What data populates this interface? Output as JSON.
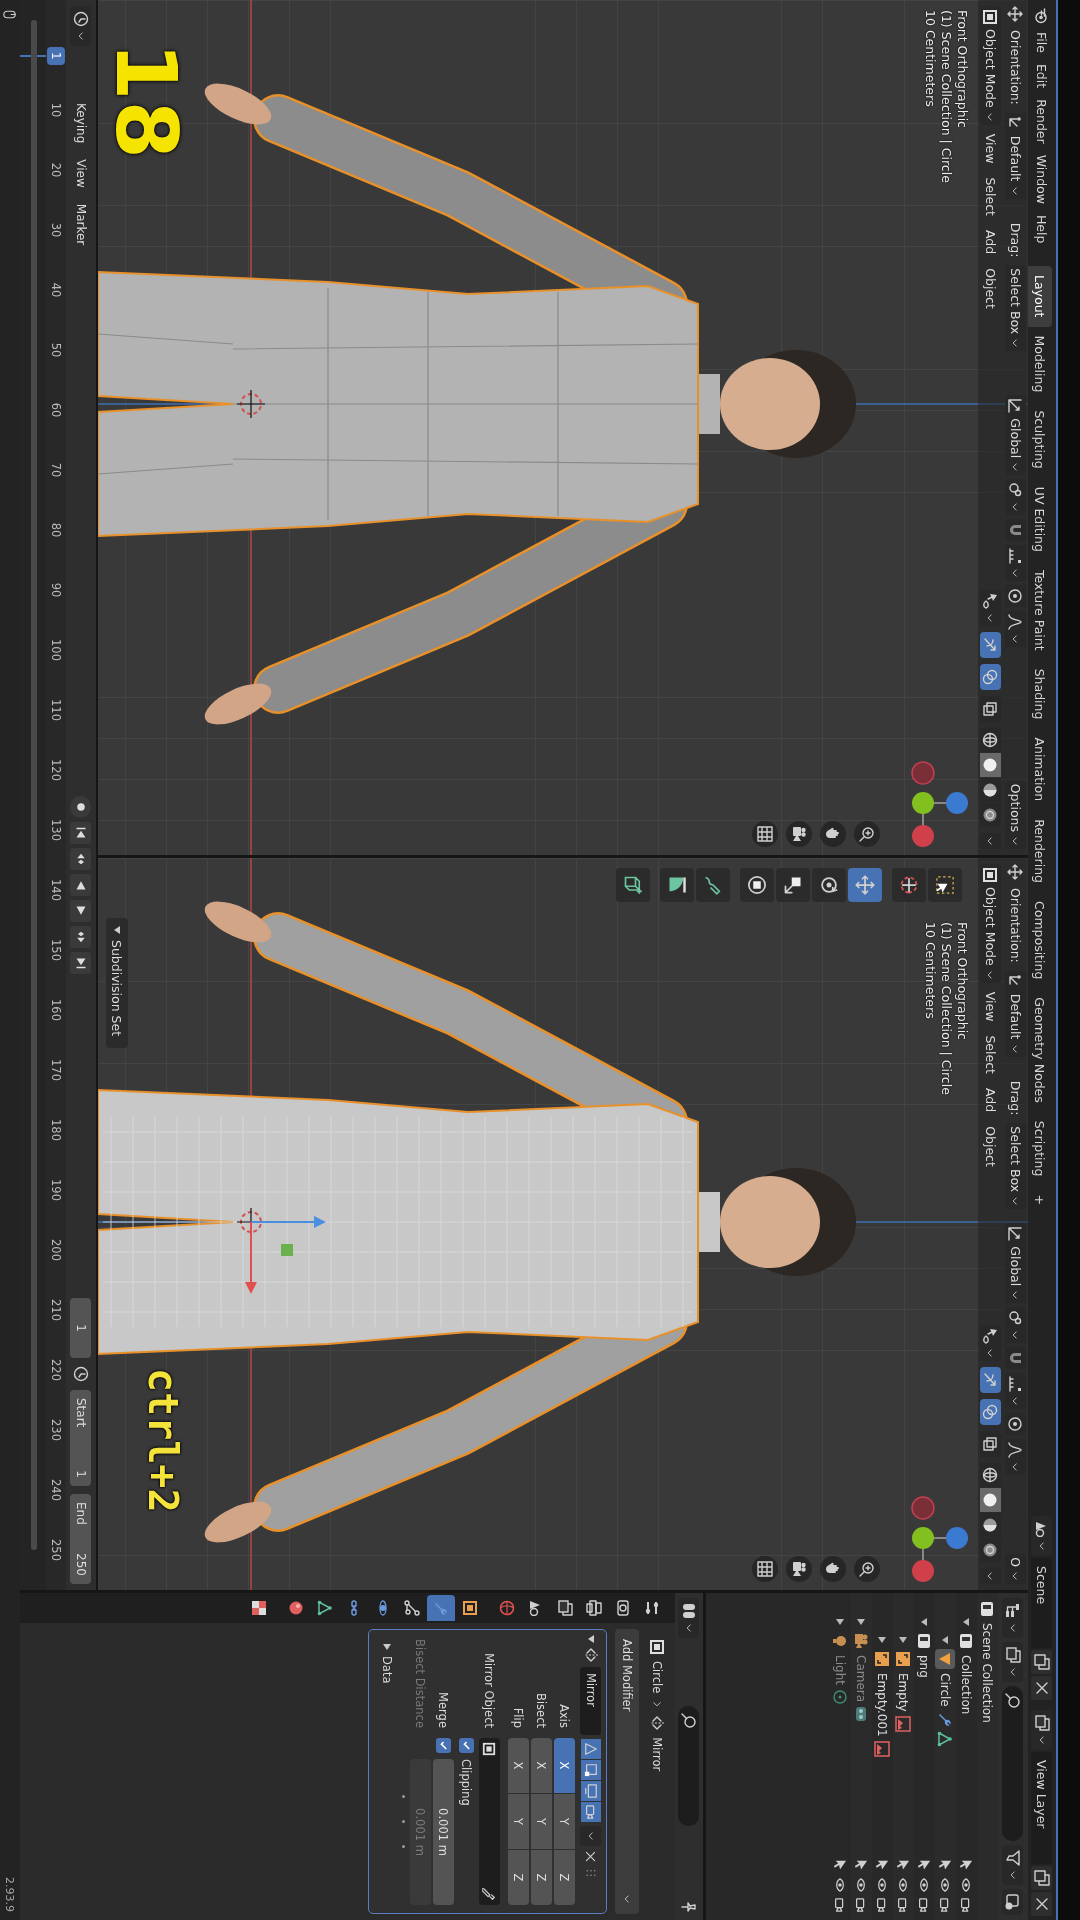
{
  "menu": [
    "File",
    "Edit",
    "Render",
    "Window",
    "Help"
  ],
  "workspaces": [
    {
      "label": "Layout",
      "selected": true
    },
    {
      "label": "Modeling",
      "selected": false
    },
    {
      "label": "Sculpting",
      "selected": false
    },
    {
      "label": "UV Editing",
      "selected": false
    },
    {
      "label": "Texture Paint",
      "selected": false
    },
    {
      "label": "Shading",
      "selected": false
    },
    {
      "label": "Animation",
      "selected": false
    },
    {
      "label": "Rendering",
      "selected": false
    },
    {
      "label": "Compositing",
      "selected": false
    },
    {
      "label": "Geometry Nodes",
      "selected": false
    },
    {
      "label": "Scripting",
      "selected": false
    }
  ],
  "add_workspace": "+",
  "scene": "Scene",
  "view_layer": "View Layer",
  "viewports": [
    {
      "orientation_label": "Orientation:",
      "orientation": "Default",
      "drag_label": "Drag:",
      "drag": "Select Box",
      "transform_orientation": "Global",
      "options": "Options",
      "mode": "Object Mode",
      "menus": [
        "View",
        "Select",
        "Add",
        "Object"
      ],
      "toggles": [
        {
          "kind": "gizmo",
          "on": true
        },
        {
          "kind": "overlay",
          "on": true
        },
        {
          "kind": "xray",
          "on": false
        }
      ],
      "shading": [
        {
          "kind": "wireframe",
          "selected": false
        },
        {
          "kind": "solid",
          "selected": true
        },
        {
          "kind": "material",
          "selected": false
        },
        {
          "kind": "rendered",
          "selected": false
        }
      ],
      "info": [
        "Front Orthographic",
        "(1) Scene Collection | Circle",
        "10 Centimeters"
      ],
      "kind": "low_poly",
      "transform_gizmo": false
    },
    {
      "orientation_label": "Orientation:",
      "orientation": "Default",
      "drag_label": "Drag:",
      "drag": "Select Box",
      "transform_orientation": "Global",
      "options": "O",
      "mode": "Object Mode",
      "menus": [
        "View",
        "Select",
        "Add",
        "Object"
      ],
      "toggles": [
        {
          "kind": "gizmo",
          "on": true
        },
        {
          "kind": "overlay",
          "on": true
        },
        {
          "kind": "xray",
          "on": false
        }
      ],
      "shading": [
        {
          "kind": "wireframe",
          "selected": false
        },
        {
          "kind": "solid",
          "selected": true
        },
        {
          "kind": "material",
          "selected": false
        },
        {
          "kind": "rendered",
          "selected": false
        }
      ],
      "info": [
        "Front Orthographic",
        "(1) Scene Collection | Circle",
        "10 Centimeters"
      ],
      "kind": "smooth",
      "transform_gizmo": true,
      "tools": [
        {
          "kind": "select_box",
          "selected": false
        },
        {
          "kind": "cursor",
          "selected": false
        },
        {
          "kind": "move",
          "selected": true
        },
        {
          "kind": "rotate",
          "selected": false
        },
        {
          "kind": "scale",
          "selected": false
        },
        {
          "kind": "transform",
          "selected": false
        },
        {
          "kind": "annotate",
          "selected": false
        },
        {
          "kind": "measure",
          "selected": false
        },
        {
          "kind": "add_cube",
          "selected": false
        }
      ],
      "operator_panel": "Subdivision Set",
      "caption": "ctrl+2"
    }
  ],
  "step_caption": "18",
  "timeline": {
    "menus": [
      "Keying",
      "View",
      "Marker"
    ],
    "current_frame": "1",
    "playhead": "1",
    "ticks": [
      "10",
      "20",
      "30",
      "40",
      "50",
      "60",
      "70",
      "80",
      "90",
      "100",
      "110",
      "120",
      "130",
      "140",
      "150",
      "160",
      "170",
      "180",
      "190",
      "200",
      "210",
      "220",
      "230",
      "240",
      "250"
    ],
    "start_label": "Start",
    "start": "1",
    "end_label": "End",
    "end": "250"
  },
  "outliner": {
    "items": [
      {
        "name": "Scene Collection",
        "kind": "scene_collection",
        "selected": false,
        "dimmed": false,
        "children": [
          {
            "name": "Collection",
            "kind": "collection",
            "selected": false,
            "dimmed": false,
            "expanded": true,
            "children": [
              {
                "name": "Circle",
                "kind": "mesh",
                "selected": true,
                "dimmed": false,
                "expanded": true
              }
            ]
          },
          {
            "name": "png",
            "kind": "collection",
            "selected": false,
            "dimmed": false,
            "expanded": true,
            "children": [
              {
                "name": "Empty",
                "kind": "image_empty",
                "selected": false,
                "dimmed": false,
                "expanded": false
              },
              {
                "name": "Empty.001",
                "kind": "image_empty",
                "selected": false,
                "dimmed": false,
                "expanded": false
              }
            ]
          },
          {
            "name": "Camera",
            "kind": "camera",
            "selected": false,
            "dimmed": true,
            "expanded": false
          },
          {
            "name": "Light",
            "kind": "light",
            "selected": false,
            "dimmed": true,
            "expanded": false
          }
        ]
      }
    ]
  },
  "properties": {
    "tabs": [
      {
        "kind": "tool",
        "selected": false
      },
      {
        "kind": "render",
        "selected": false
      },
      {
        "kind": "output",
        "selected": false
      },
      {
        "kind": "view_layer",
        "selected": false
      },
      {
        "kind": "scene",
        "selected": false
      },
      {
        "kind": "world",
        "selected": false
      },
      {
        "kind": "object",
        "selected": false
      },
      {
        "kind": "modifiers",
        "selected": true
      },
      {
        "kind": "particles",
        "selected": false
      },
      {
        "kind": "physics",
        "selected": false
      },
      {
        "kind": "constraints",
        "selected": false
      },
      {
        "kind": "data",
        "selected": false
      },
      {
        "kind": "material",
        "selected": false
      },
      {
        "kind": "texture",
        "selected": false
      }
    ],
    "object": "Circle",
    "modifier_crumb": "Mirror",
    "add_modifier": "Add Modifier",
    "modifier": {
      "name": "Mirror",
      "expanded": true,
      "display": [
        {
          "kind": "on_cage",
          "on": true
        },
        {
          "kind": "edit_mode",
          "on": true
        },
        {
          "kind": "realtime",
          "on": true
        },
        {
          "kind": "render",
          "on": true
        }
      ],
      "axis_rows": [
        {
          "label": "Axis",
          "toggles": [
            {
              "label": "X",
              "selected": true
            },
            {
              "label": "Y",
              "selected": false
            },
            {
              "label": "Z",
              "selected": false
            }
          ]
        },
        {
          "label": "Bisect",
          "toggles": [
            {
              "label": "X",
              "selected": false
            },
            {
              "label": "Y",
              "selected": false
            },
            {
              "label": "Z",
              "selected": false
            }
          ]
        },
        {
          "label": "Flip",
          "toggles": [
            {
              "label": "X",
              "selected": false
            },
            {
              "label": "Y",
              "selected": false
            },
            {
              "label": "Z",
              "selected": false
            }
          ]
        }
      ],
      "mirror_object": "Mirror Object",
      "clipping": {
        "label": "Clipping",
        "checked": true
      },
      "merge": {
        "label": "Merge",
        "checked": true,
        "value": "0.001 m"
      },
      "bisect_distance": {
        "label": "Bisect Distance",
        "value": "0.001 m",
        "disabled": true
      },
      "data": {
        "label": "Data",
        "expanded": false
      }
    }
  },
  "version": "2.93.9"
}
